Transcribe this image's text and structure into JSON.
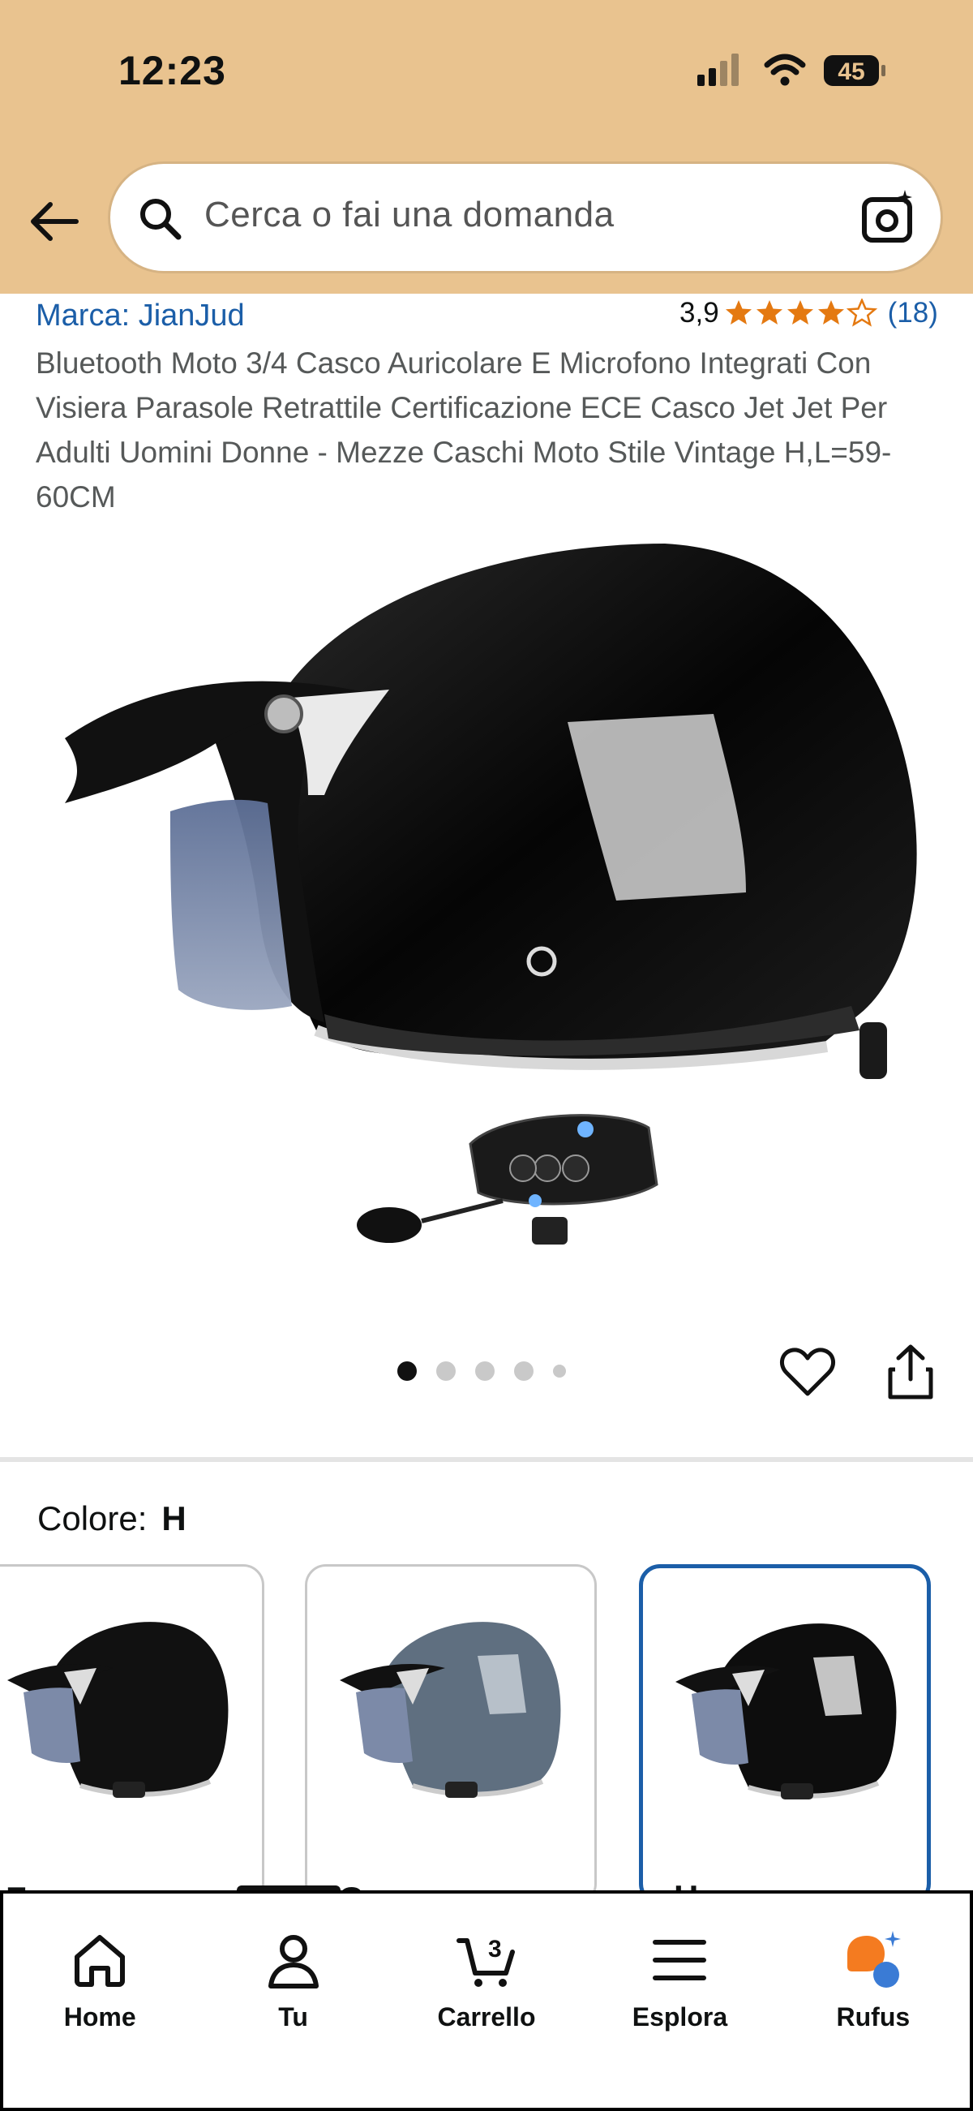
{
  "status_bar": {
    "time": "12:23",
    "battery": "45"
  },
  "search": {
    "placeholder": "Cerca o fai una domanda"
  },
  "product": {
    "brand": "Marca: JianJud",
    "rating_value": "3,9",
    "rating_stars": 3.9,
    "rating_count": "(18)",
    "title": "Bluetooth Moto 3/4 Casco Auricolare E Microfono Integrati Con Visiera Parasole Retrattile Certificazione ECE Casco Jet Jet Per Adulti Uomini Donne - Mezze Caschi Moto Stile Vintage H,L=59-60CM",
    "image_count": 5,
    "image_index": 1
  },
  "color": {
    "label": "Colore:",
    "selected": "H",
    "options": [
      {
        "label": "F",
        "helmet_color": "#111111"
      },
      {
        "label": "G",
        "helmet_color": "#5f6f80"
      },
      {
        "label": "H",
        "helmet_color": "#0d0d0d"
      }
    ]
  },
  "nav": {
    "items": [
      {
        "label": "Home",
        "icon": "home-icon"
      },
      {
        "label": "Tu",
        "icon": "user-icon"
      },
      {
        "label": "Carrello",
        "icon": "cart-icon",
        "badge": "3"
      },
      {
        "label": "Esplora",
        "icon": "menu-icon"
      },
      {
        "label": "Rufus",
        "icon": "rufus-icon"
      }
    ]
  },
  "colors": {
    "header_bg": "#e9c38f",
    "link": "#1b5ea8",
    "star": "#e47911",
    "rufus_orange": "#f47b20",
    "rufus_blue": "#3a7bd5"
  }
}
